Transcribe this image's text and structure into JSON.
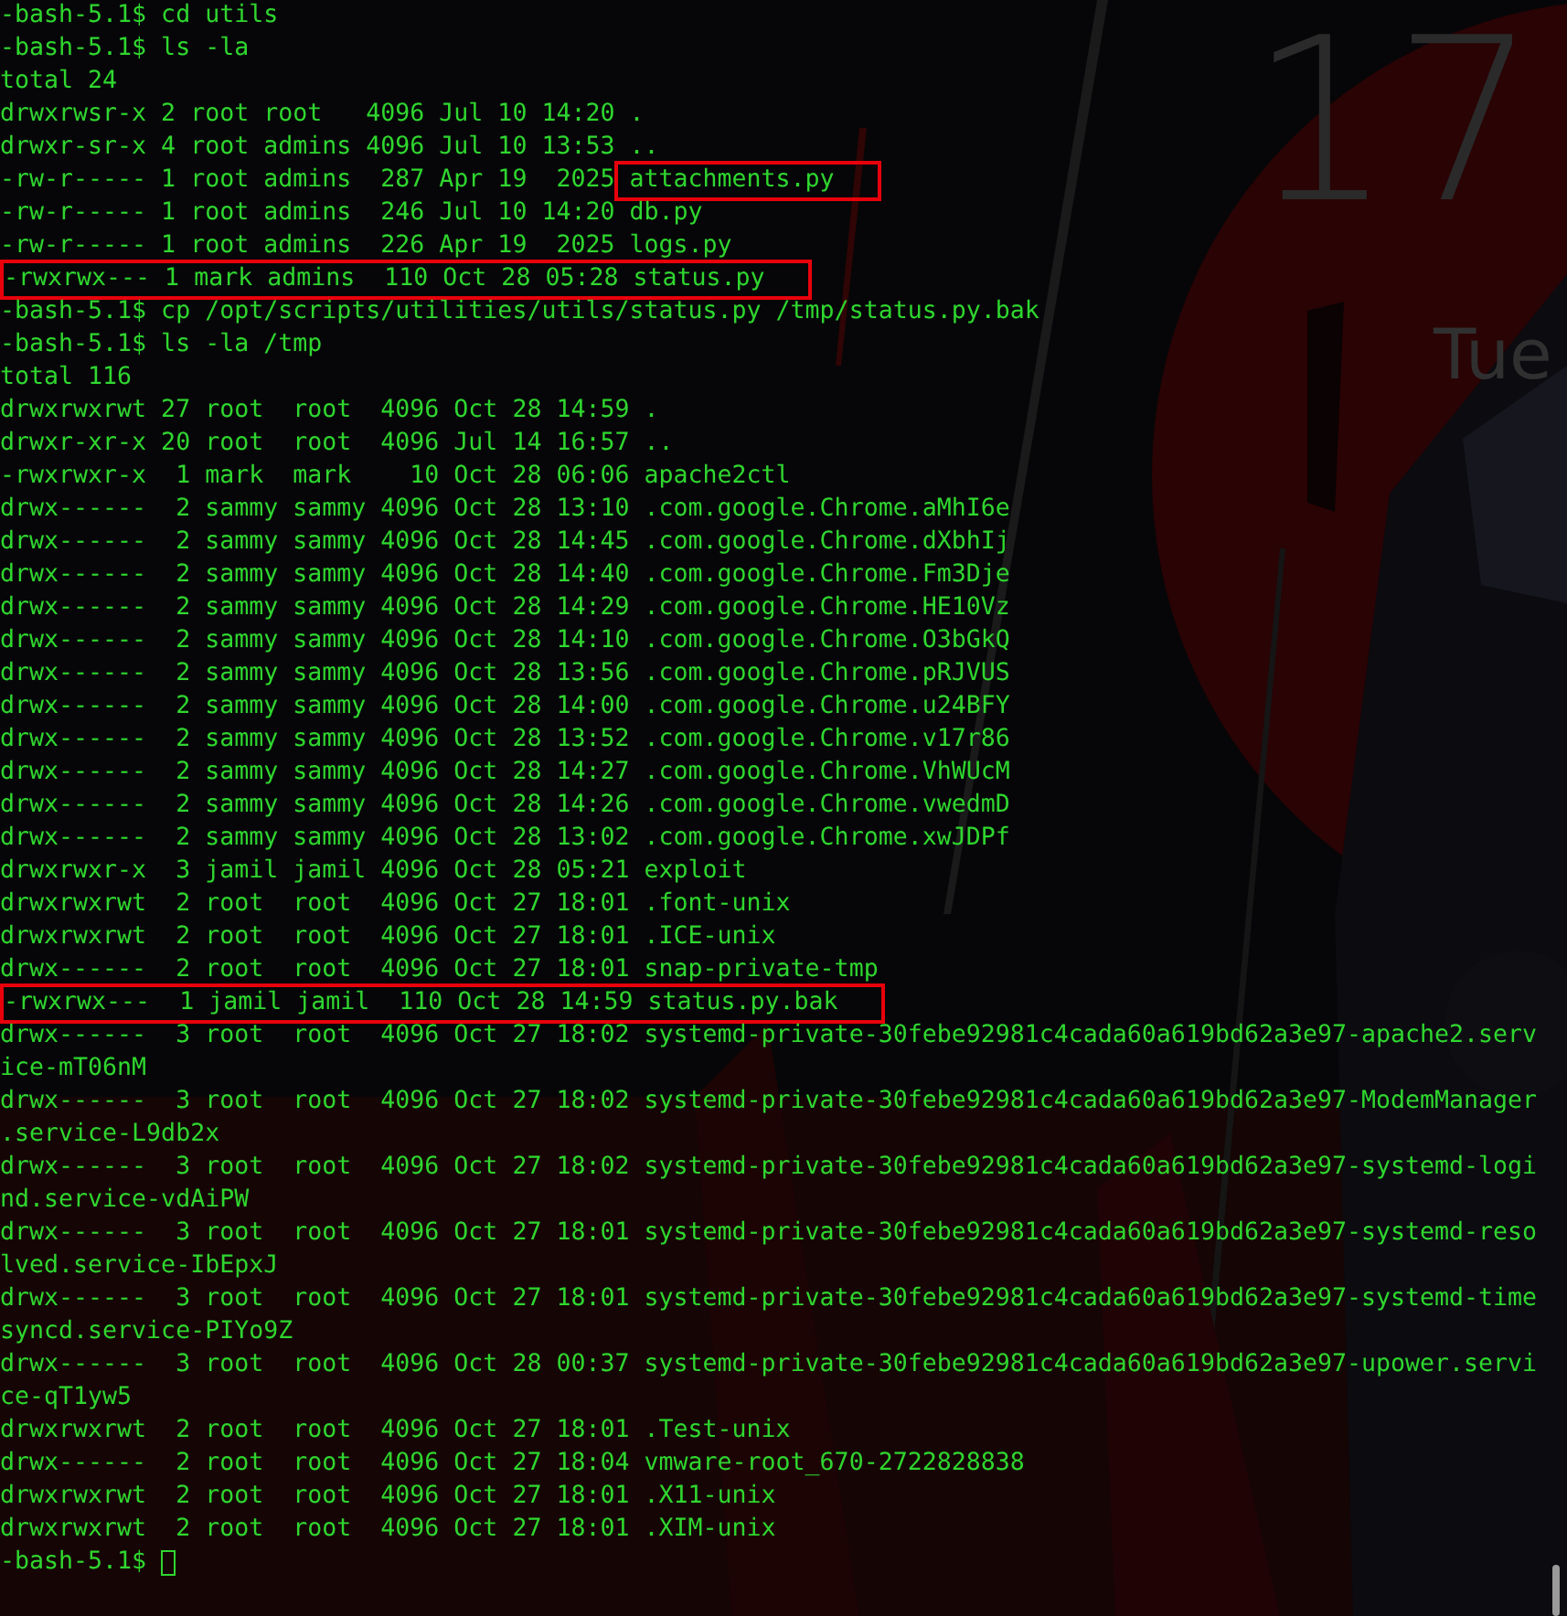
{
  "wallpaper": {
    "kind": "picture",
    "clock_time": "17",
    "clock_day": "Tue"
  },
  "terminal": {
    "lines": [
      {
        "parts": [
          {
            "text": "-bash-5.1$ cd utils",
            "boxed": false
          }
        ]
      },
      {
        "parts": [
          {
            "text": "-bash-5.1$ ls -la",
            "boxed": false
          }
        ]
      },
      {
        "parts": [
          {
            "text": "total 24",
            "boxed": false
          }
        ]
      },
      {
        "parts": [
          {
            "text": "drwxrwsr-x 2 root root   4096 Jul 10 14:20 .",
            "boxed": false
          }
        ]
      },
      {
        "parts": [
          {
            "text": "drwxr-sr-x 4 root admins 4096 Jul 10 13:53 ..",
            "boxed": false
          }
        ]
      },
      {
        "parts": [
          {
            "text": "-rw-r----- 1 root admins  287 Apr 19  2025 ",
            "boxed": false
          },
          {
            "text": "attachments.py",
            "boxed": true
          }
        ]
      },
      {
        "parts": [
          {
            "text": "-rw-r----- 1 root admins  246 Jul 10 14:20 db.py",
            "boxed": false
          }
        ]
      },
      {
        "parts": [
          {
            "text": "-rw-r----- 1 root admins  226 Apr 19  2025 logs.py",
            "boxed": false
          }
        ]
      },
      {
        "parts": [
          {
            "text": "-rwxrwx--- 1 mark admins  110 Oct 28 05:28 status.py",
            "boxed": true
          }
        ]
      },
      {
        "parts": [
          {
            "text": "-bash-5.1$ cp /opt/scripts/utilities/utils/status.py /tmp/status.py.bak",
            "boxed": false
          }
        ]
      },
      {
        "parts": [
          {
            "text": "-bash-5.1$ ls -la /tmp",
            "boxed": false
          }
        ]
      },
      {
        "parts": [
          {
            "text": "total 116",
            "boxed": false
          }
        ]
      },
      {
        "parts": [
          {
            "text": "drwxrwxrwt 27 root  root  4096 Oct 28 14:59 .",
            "boxed": false
          }
        ]
      },
      {
        "parts": [
          {
            "text": "drwxr-xr-x 20 root  root  4096 Jul 14 16:57 ..",
            "boxed": false
          }
        ]
      },
      {
        "parts": [
          {
            "text": "-rwxrwxr-x  1 mark  mark    10 Oct 28 06:06 apache2ctl",
            "boxed": false
          }
        ]
      },
      {
        "parts": [
          {
            "text": "drwx------  2 sammy sammy 4096 Oct 28 13:10 .com.google.Chrome.aMhI6e",
            "boxed": false
          }
        ]
      },
      {
        "parts": [
          {
            "text": "drwx------  2 sammy sammy 4096 Oct 28 14:45 .com.google.Chrome.dXbhIj",
            "boxed": false
          }
        ]
      },
      {
        "parts": [
          {
            "text": "drwx------  2 sammy sammy 4096 Oct 28 14:40 .com.google.Chrome.Fm3Dje",
            "boxed": false
          }
        ]
      },
      {
        "parts": [
          {
            "text": "drwx------  2 sammy sammy 4096 Oct 28 14:29 .com.google.Chrome.HE10Vz",
            "boxed": false
          }
        ]
      },
      {
        "parts": [
          {
            "text": "drwx------  2 sammy sammy 4096 Oct 28 14:10 .com.google.Chrome.O3bGkQ",
            "boxed": false
          }
        ]
      },
      {
        "parts": [
          {
            "text": "drwx------  2 sammy sammy 4096 Oct 28 13:56 .com.google.Chrome.pRJVUS",
            "boxed": false
          }
        ]
      },
      {
        "parts": [
          {
            "text": "drwx------  2 sammy sammy 4096 Oct 28 14:00 .com.google.Chrome.u24BFY",
            "boxed": false
          }
        ]
      },
      {
        "parts": [
          {
            "text": "drwx------  2 sammy sammy 4096 Oct 28 13:52 .com.google.Chrome.v17r86",
            "boxed": false
          }
        ]
      },
      {
        "parts": [
          {
            "text": "drwx------  2 sammy sammy 4096 Oct 28 14:27 .com.google.Chrome.VhWUcM",
            "boxed": false
          }
        ]
      },
      {
        "parts": [
          {
            "text": "drwx------  2 sammy sammy 4096 Oct 28 14:26 .com.google.Chrome.vwedmD",
            "boxed": false
          }
        ]
      },
      {
        "parts": [
          {
            "text": "drwx------  2 sammy sammy 4096 Oct 28 13:02 .com.google.Chrome.xwJDPf",
            "boxed": false
          }
        ]
      },
      {
        "parts": [
          {
            "text": "drwxrwxr-x  3 jamil jamil 4096 Oct 28 05:21 exploit",
            "boxed": false
          }
        ]
      },
      {
        "parts": [
          {
            "text": "drwxrwxrwt  2 root  root  4096 Oct 27 18:01 .font-unix",
            "boxed": false
          }
        ]
      },
      {
        "parts": [
          {
            "text": "drwxrwxrwt  2 root  root  4096 Oct 27 18:01 .ICE-unix",
            "boxed": false
          }
        ]
      },
      {
        "parts": [
          {
            "text": "drwx------  2 root  root  4096 Oct 27 18:01 snap-private-tmp",
            "boxed": false
          }
        ]
      },
      {
        "parts": [
          {
            "text": "-rwxrwx---  1 jamil jamil  110 Oct 28 14:59 status.py.bak",
            "boxed": true
          }
        ]
      },
      {
        "parts": [
          {
            "text": "drwx------  3 root  root  4096 Oct 27 18:02 systemd-private-30febe92981c4cada60a619bd62a3e97-apache2.serv",
            "boxed": false
          }
        ]
      },
      {
        "parts": [
          {
            "text": "ice-mT06nM",
            "boxed": false
          }
        ]
      },
      {
        "parts": [
          {
            "text": "drwx------  3 root  root  4096 Oct 27 18:02 systemd-private-30febe92981c4cada60a619bd62a3e97-ModemManager",
            "boxed": false
          }
        ]
      },
      {
        "parts": [
          {
            "text": ".service-L9db2x",
            "boxed": false
          }
        ]
      },
      {
        "parts": [
          {
            "text": "drwx------  3 root  root  4096 Oct 27 18:02 systemd-private-30febe92981c4cada60a619bd62a3e97-systemd-logi",
            "boxed": false
          }
        ]
      },
      {
        "parts": [
          {
            "text": "nd.service-vdAiPW",
            "boxed": false
          }
        ]
      },
      {
        "parts": [
          {
            "text": "drwx------  3 root  root  4096 Oct 27 18:01 systemd-private-30febe92981c4cada60a619bd62a3e97-systemd-reso",
            "boxed": false
          }
        ]
      },
      {
        "parts": [
          {
            "text": "lved.service-IbEpxJ",
            "boxed": false
          }
        ]
      },
      {
        "parts": [
          {
            "text": "drwx------  3 root  root  4096 Oct 27 18:01 systemd-private-30febe92981c4cada60a619bd62a3e97-systemd-time",
            "boxed": false
          }
        ]
      },
      {
        "parts": [
          {
            "text": "syncd.service-PIYo9Z",
            "boxed": false
          }
        ]
      },
      {
        "parts": [
          {
            "text": "drwx------  3 root  root  4096 Oct 28 00:37 systemd-private-30febe92981c4cada60a619bd62a3e97-upower.servi",
            "boxed": false
          }
        ]
      },
      {
        "parts": [
          {
            "text": "ce-qT1yw5",
            "boxed": false
          }
        ]
      },
      {
        "parts": [
          {
            "text": "drwxrwxrwt  2 root  root  4096 Oct 27 18:01 .Test-unix",
            "boxed": false
          }
        ]
      },
      {
        "parts": [
          {
            "text": "drwx------  2 root  root  4096 Oct 27 18:04 vmware-root_670-2722828838",
            "boxed": false
          }
        ]
      },
      {
        "parts": [
          {
            "text": "drwxrwxrwt  2 root  root  4096 Oct 27 18:01 .X11-unix",
            "boxed": false
          }
        ]
      },
      {
        "parts": [
          {
            "text": "drwxrwxrwt  2 root  root  4096 Oct 27 18:01 .XIM-unix",
            "boxed": false
          }
        ]
      }
    ],
    "prompt": "-bash-5.1$"
  }
}
